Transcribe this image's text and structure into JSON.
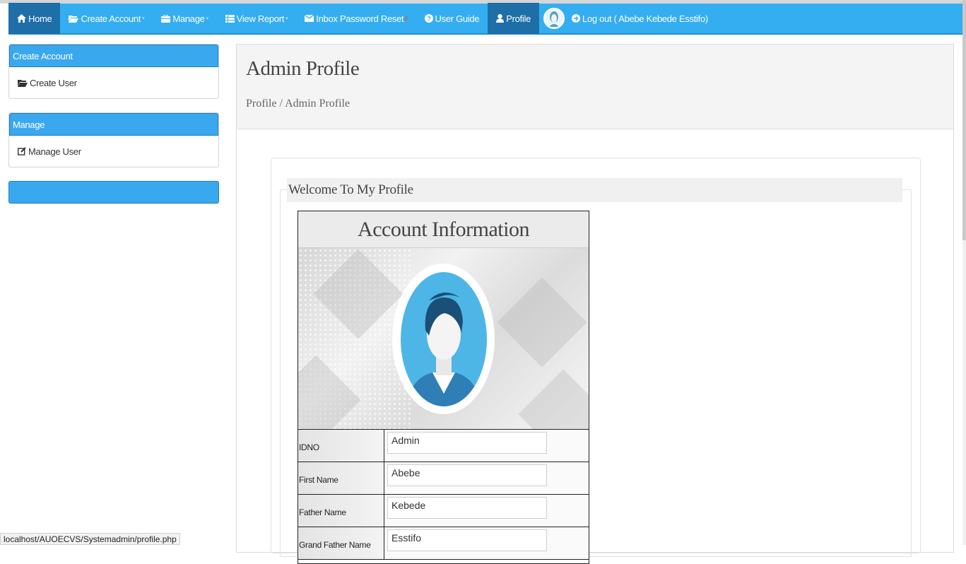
{
  "nav": {
    "home": "Home",
    "create_account": "Create Account",
    "manage": "Manage",
    "view_report": "View Report",
    "inbox_reset": "Inbox Password Reset",
    "inbox_count": "0",
    "user_guide": "User Guide",
    "profile": "Profile",
    "logout": "Log out ( Abebe Kebede Esstifo)"
  },
  "sidebar": {
    "create_account_header": "Create Account",
    "create_user": "Create User",
    "manage_header": "Manage",
    "manage_user": "Manage User"
  },
  "main": {
    "title": "Admin Profile",
    "breadcrumb": "Profile / Admin Profile",
    "welcome": "Welcome To My Profile"
  },
  "account": {
    "title": "Account Information",
    "fields": [
      {
        "label": "IDNO",
        "value": "Admin"
      },
      {
        "label": "First Name",
        "value": "Abebe"
      },
      {
        "label": "Father Name",
        "value": "Kebede"
      },
      {
        "label": "Grand Father Name",
        "value": "Esstifo"
      }
    ]
  },
  "statusbar": {
    "url": "localhost/AUOECVS/Systemadmin/profile.php"
  },
  "colors": {
    "nav_bg": "#34aef0",
    "nav_active": "#1e6ea8",
    "panel_header": "#3aa8ee"
  }
}
